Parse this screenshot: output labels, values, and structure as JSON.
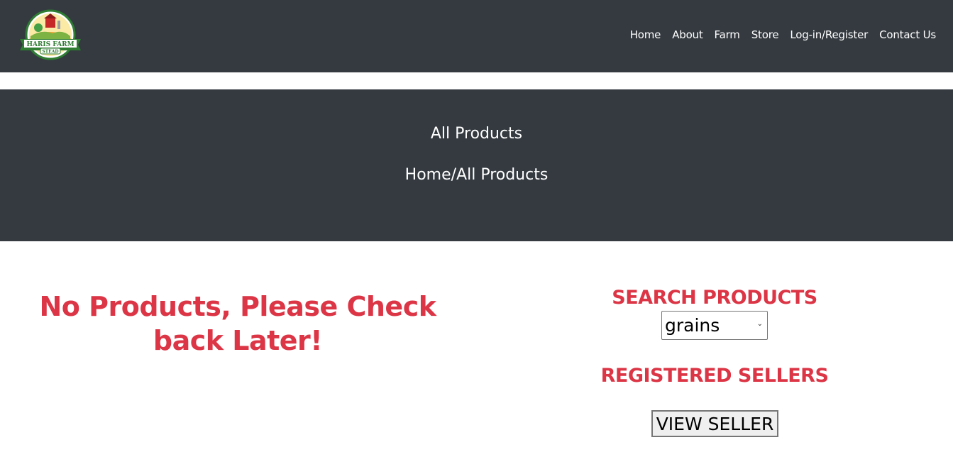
{
  "header": {
    "logo": {
      "line1": "HARIS FARM",
      "line2": "STEAD"
    },
    "nav": [
      "Home",
      "About",
      "Farm",
      "Store",
      "Log-in/Register",
      "Contact Us"
    ]
  },
  "hero": {
    "title": "All Products",
    "breadcrumb": "Home/All Products"
  },
  "main": {
    "empty_message": "No Products, Please Check back Later!"
  },
  "sidebar": {
    "search_heading": "SEARCH PRODUCTS",
    "category_selected": "grains",
    "sellers_heading": "REGISTERED SELLERS",
    "view_seller_label": "VIEW SELLER"
  },
  "colors": {
    "dark_bg": "#343a40",
    "accent_red": "#dc3545"
  }
}
